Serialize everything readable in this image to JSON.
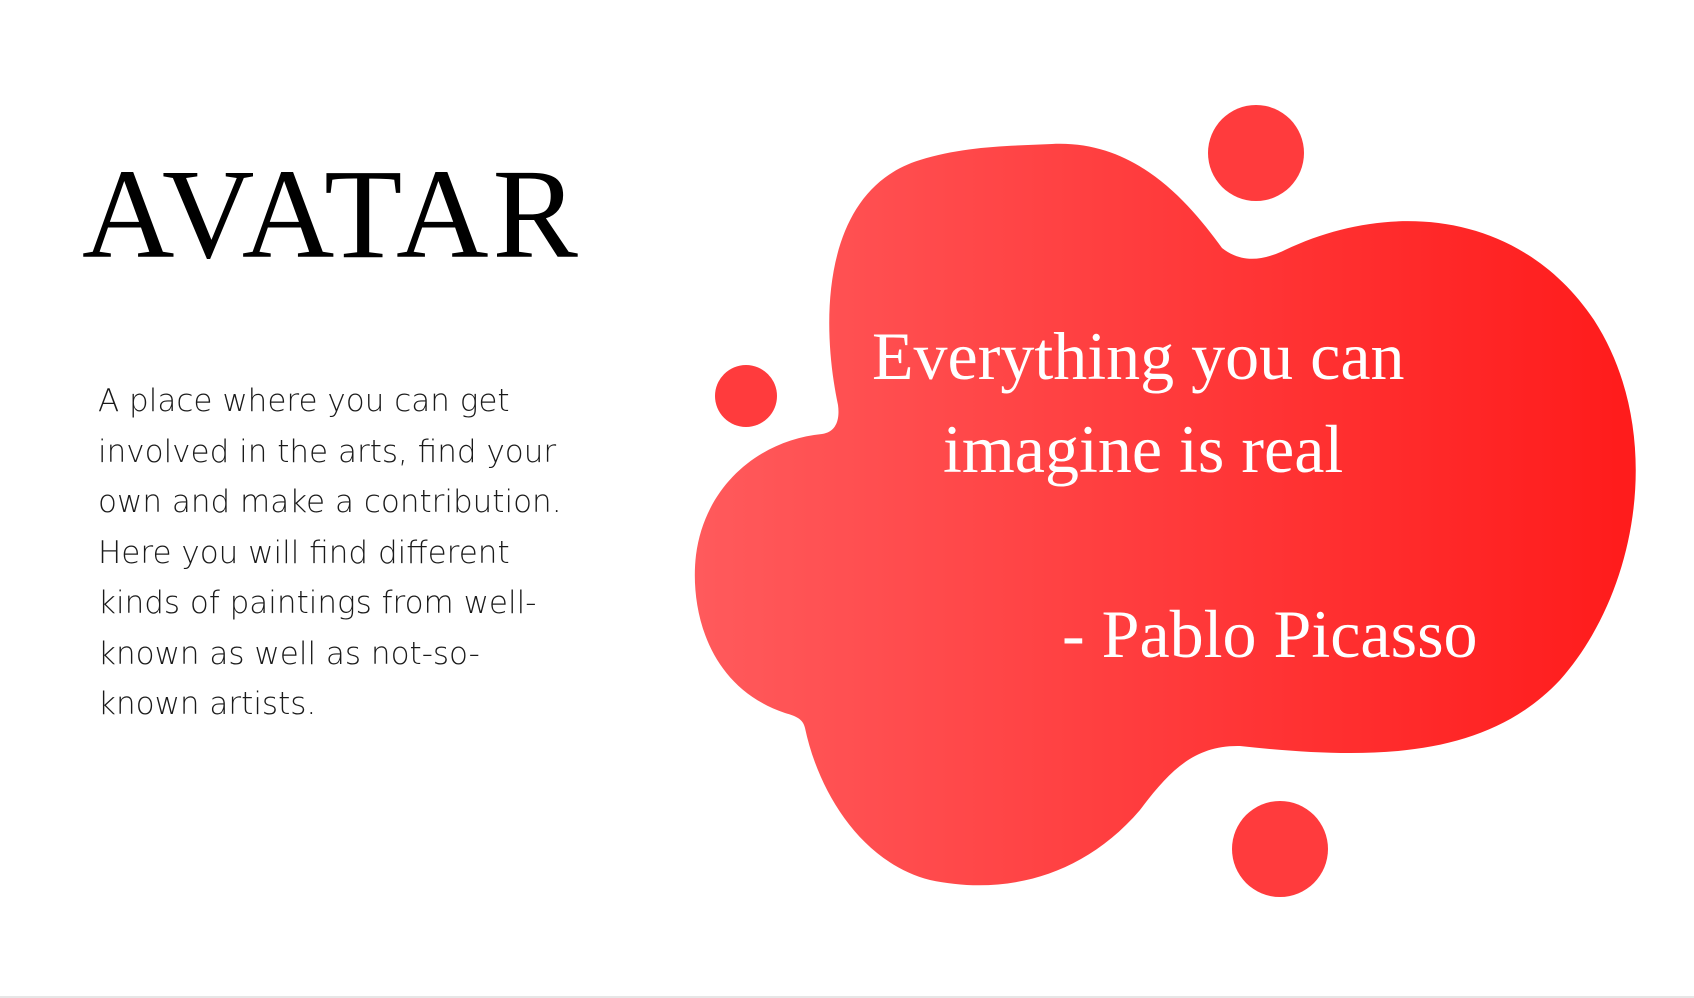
{
  "hero": {
    "title": "AVATAR",
    "description_lines": [
      "A place where you can get",
      "involved in the arts, find your",
      "own and make a contribution.",
      "Here you will find different",
      "kinds of paintings from well-",
      "known as well as not-so-",
      "known artists."
    ]
  },
  "quote": {
    "lines": [
      "Everything you can",
      "imagine is real"
    ],
    "author": "- Pablo Picasso"
  },
  "colors": {
    "blob_gradient_start": "#ff5a5c",
    "blob_gradient_end": "#ff1b1b",
    "dot_color": "#ff3b3d",
    "quote_text": "#ffffff",
    "title_text": "#000000"
  }
}
